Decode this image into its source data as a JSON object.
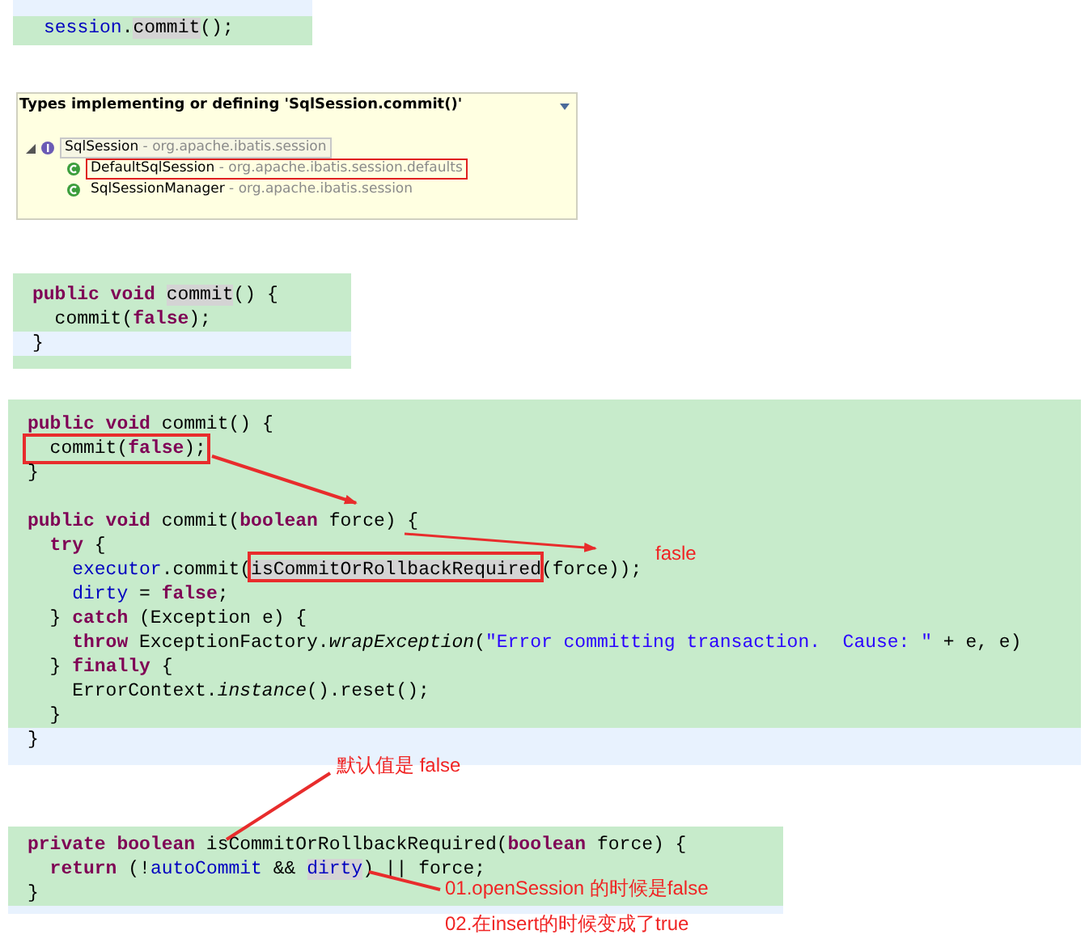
{
  "snippets": [
    {
      "lines": [
        {
          "current": false,
          "tokens": [
            {
              "kind": "field",
              "text": "session"
            },
            {
              "kind": "plain",
              "text": "."
            },
            {
              "kind": "occurrence",
              "text": "commit"
            },
            {
              "kind": "plain",
              "text": "();"
            }
          ]
        }
      ]
    },
    {
      "lines": [
        {
          "current": false,
          "tokens": [
            {
              "kind": "keyword",
              "text": "public void "
            },
            {
              "kind": "occurrence",
              "text": "commit"
            },
            {
              "kind": "plain",
              "text": "() {"
            }
          ]
        },
        {
          "current": false,
          "tokens": [
            {
              "kind": "plain",
              "text": "  commit("
            },
            {
              "kind": "keyword",
              "text": "false"
            },
            {
              "kind": "plain",
              "text": ");"
            }
          ]
        },
        {
          "current": true,
          "tokens": [
            {
              "kind": "plain",
              "text": "}"
            }
          ]
        }
      ]
    },
    {
      "lines": [
        {
          "current": false,
          "framed": false,
          "tokens": [
            {
              "kind": "keyword",
              "text": "public void "
            },
            {
              "kind": "plain",
              "text": "commit() {"
            }
          ]
        },
        {
          "current": false,
          "framed": true,
          "tokens": [
            {
              "kind": "plain",
              "text": "  commit("
            },
            {
              "kind": "keyword",
              "text": "false"
            },
            {
              "kind": "plain",
              "text": ");"
            }
          ]
        },
        {
          "current": false,
          "framed": false,
          "tokens": [
            {
              "kind": "plain",
              "text": "}"
            }
          ]
        },
        {
          "current": false,
          "framed": false
        },
        {
          "current": false,
          "framed": false,
          "tokens": [
            {
              "kind": "keyword",
              "text": "public void "
            },
            {
              "kind": "plain",
              "text": "commit("
            },
            {
              "kind": "keyword",
              "text": "boolean "
            },
            {
              "kind": "plain",
              "text": "force) {"
            }
          ]
        },
        {
          "current": false,
          "framed": false,
          "tokens": [
            {
              "kind": "keyword",
              "text": "  try "
            },
            {
              "kind": "plain",
              "text": "{"
            }
          ]
        },
        {
          "current": false,
          "framed": false,
          "tokens": [
            {
              "kind": "field",
              "text": "    executor"
            },
            {
              "kind": "plain",
              "text": ".commit("
            },
            {
              "kind": "occurrence",
              "text": "isCommitOrRollbackRequired"
            },
            {
              "kind": "plain",
              "text": "(force));"
            }
          ]
        },
        {
          "current": false,
          "framed": false,
          "tokens": [
            {
              "kind": "field",
              "text": "    dirty"
            },
            {
              "kind": "plain",
              "text": " = "
            },
            {
              "kind": "keyword",
              "text": "false"
            },
            {
              "kind": "plain",
              "text": ";"
            }
          ]
        },
        {
          "current": false,
          "framed": false,
          "tokens": [
            {
              "kind": "plain",
              "text": "  } "
            },
            {
              "kind": "keyword",
              "text": "catch"
            },
            {
              "kind": "plain",
              "text": " (Exception e) {"
            }
          ]
        },
        {
          "current": false,
          "framed": false,
          "tokens": [
            {
              "kind": "keyword",
              "text": "    throw "
            },
            {
              "kind": "plain",
              "text": "ExceptionFactory."
            },
            {
              "kind": "italic",
              "text": "wrapException"
            },
            {
              "kind": "plain",
              "text": "("
            },
            {
              "kind": "string",
              "text": "\"Error committing transaction.  Cause: \""
            },
            {
              "kind": "plain",
              "text": " + e, e)"
            }
          ]
        },
        {
          "current": false,
          "framed": false,
          "tokens": [
            {
              "kind": "plain",
              "text": "  } "
            },
            {
              "kind": "keyword",
              "text": "finally"
            },
            {
              "kind": "plain",
              "text": " {"
            }
          ]
        },
        {
          "current": false,
          "framed": false,
          "tokens": [
            {
              "kind": "plain",
              "text": "    ErrorContext."
            },
            {
              "kind": "italic",
              "text": "instance"
            },
            {
              "kind": "plain",
              "text": "().reset();"
            }
          ]
        },
        {
          "current": false,
          "framed": false,
          "tokens": [
            {
              "kind": "plain",
              "text": "  }"
            }
          ]
        },
        {
          "current": true,
          "framed": false,
          "tokens": [
            {
              "kind": "plain",
              "text": "}"
            }
          ]
        }
      ]
    },
    {
      "lines": [
        {
          "current": false,
          "tokens": [
            {
              "kind": "keyword",
              "text": "private boolean "
            },
            {
              "kind": "plain",
              "text": "isCommitOrRollbackRequired("
            },
            {
              "kind": "keyword",
              "text": "boolean "
            },
            {
              "kind": "plain",
              "text": "force) {"
            }
          ]
        },
        {
          "current": false,
          "tokens": [
            {
              "kind": "keyword",
              "text": "  return "
            },
            {
              "kind": "plain",
              "text": "(!"
            },
            {
              "kind": "field",
              "text": "autoCommit"
            },
            {
              "kind": "plain",
              "text": " && "
            },
            {
              "kind": "occurrence_field",
              "text": "dirty"
            },
            {
              "kind": "plain",
              "text": ") || force;"
            }
          ]
        },
        {
          "current": false,
          "tokens": [
            {
              "kind": "plain",
              "text": "}"
            }
          ]
        }
      ]
    }
  ],
  "popup": {
    "title": "Types implementing or defining 'SqlSession.commit()'",
    "tree": [
      {
        "kind": "interface",
        "name": "SqlSession",
        "package": "- org.apache.ibatis.session",
        "expanded": true,
        "selected": true,
        "marked": false,
        "children": [
          {
            "kind": "class",
            "name": "DefaultSqlSession",
            "package": "- org.apache.ibatis.session.defaults",
            "selected": false,
            "marked": true
          },
          {
            "kind": "class",
            "name": "SqlSessionManager",
            "package": "- org.apache.ibatis.session",
            "selected": false,
            "marked": false
          }
        ]
      }
    ]
  },
  "annotations": {
    "force_value": "fasle",
    "default_value": "默认值是 false",
    "dirty_notes": [
      "01.openSession 的时候是false",
      "02.在insert的时候变成了true"
    ]
  }
}
